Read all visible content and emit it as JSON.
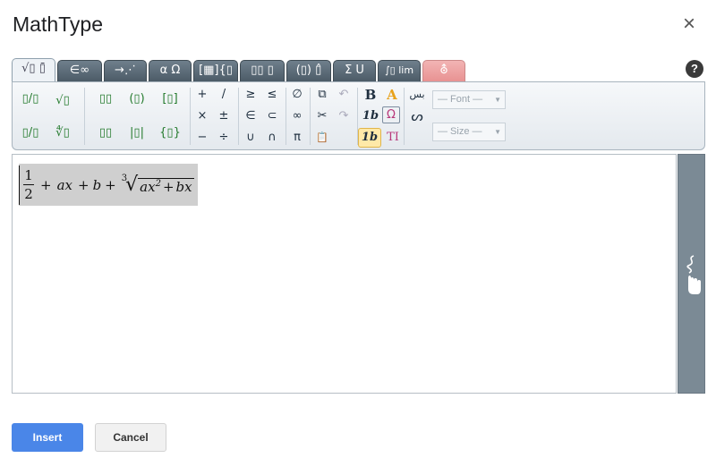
{
  "dialog": {
    "title": "MathType",
    "close_label": "×",
    "help_label": "?"
  },
  "tabs": [
    "√▯ ▯̄",
    "∈∞",
    "→⋰",
    "α Ω",
    "[▦]{▯",
    "▯▯ ▯",
    "(▯) ▯̂",
    "Σ U",
    "∫▯ lim",
    "⛢"
  ],
  "toolbar": {
    "fraction": "▯/▯",
    "sqrt": "√▯",
    "superscript": "▯▯",
    "parens": "(▯)",
    "brackets": "[▯]",
    "bevel_fraction": "▯/▯",
    "nth_root": "∜▯",
    "subscript": "▯▯",
    "abs": "|▯|",
    "braces": "{▯}",
    "plus": "+",
    "slash": "/",
    "times": "×",
    "plusminus": "±",
    "minus": "−",
    "divide": "÷",
    "geq": "≥",
    "leq": "≤",
    "in": "∈",
    "subset": "⊂",
    "union": "∪",
    "intersection": "∩",
    "emptyset": "∅",
    "infinity": "∞",
    "pi": "π",
    "copy": "⧉",
    "cut": "✂",
    "paste": "📋",
    "undo": "↶",
    "redo": "↷",
    "bold": "B",
    "color": "A",
    "italic_bold": "1b",
    "special_chars": "Ω",
    "math_style": "1b",
    "text_mode": "TI",
    "rtl": "بس",
    "handwriting": "ᔕ",
    "font_placeholder": "— Font —",
    "size_placeholder": "— Size —"
  },
  "formula": {
    "numerator": "1",
    "denominator": "2",
    "plus1": "+",
    "term_ax": "ax",
    "plus2": "+",
    "term_b": "b",
    "plus3": "+",
    "root_index": "3",
    "rad_a": "ax",
    "rad_exp": "2",
    "rad_plus": "+",
    "rad_bx": "bx"
  },
  "buttons": {
    "insert": "Insert",
    "cancel": "Cancel"
  }
}
